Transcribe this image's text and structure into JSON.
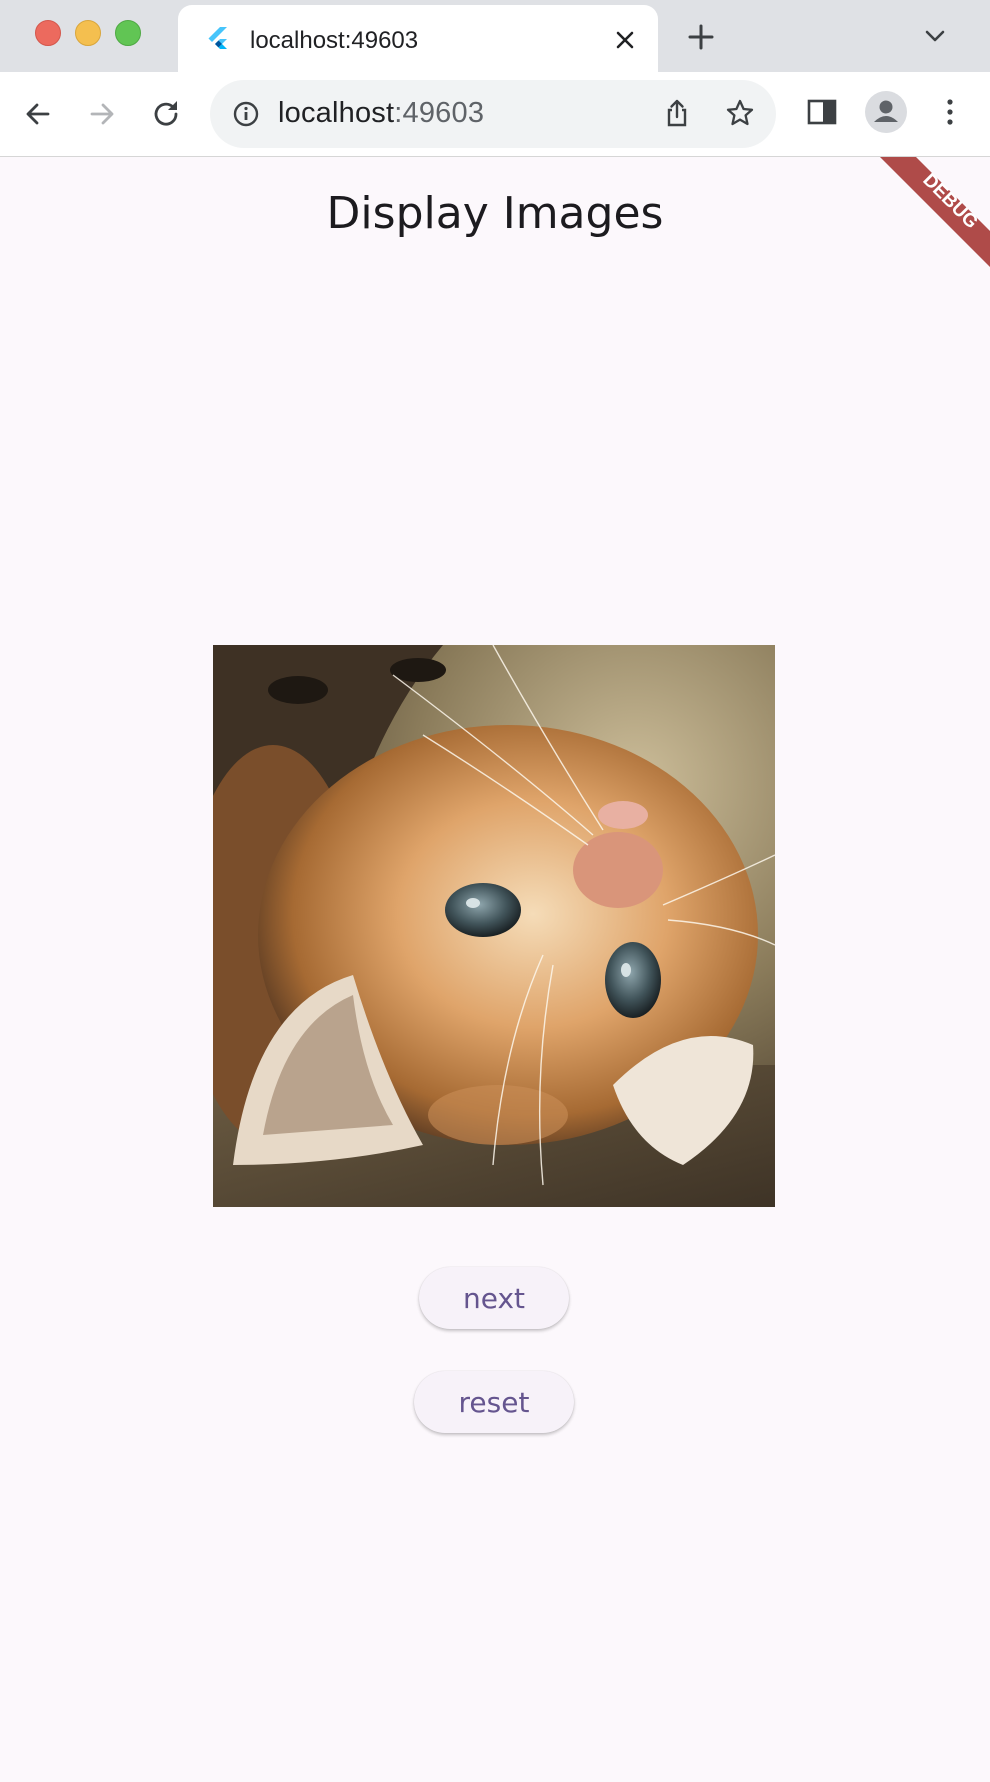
{
  "browser": {
    "tab": {
      "title": "localhost:49603"
    },
    "address_bar": {
      "host": "localhost",
      "port": ":49603"
    }
  },
  "page": {
    "title": "Display Images",
    "debug_banner": "DEBUG",
    "image": {
      "subject": "kitten lying on its back on a wooden floor"
    },
    "buttons": {
      "next": "next",
      "reset": "reset"
    }
  },
  "colors": {
    "background": "#fcf8fc",
    "button_text": "#65558f",
    "button_fill": "#f7f2f9",
    "debug_banner": "#a83c3a"
  }
}
